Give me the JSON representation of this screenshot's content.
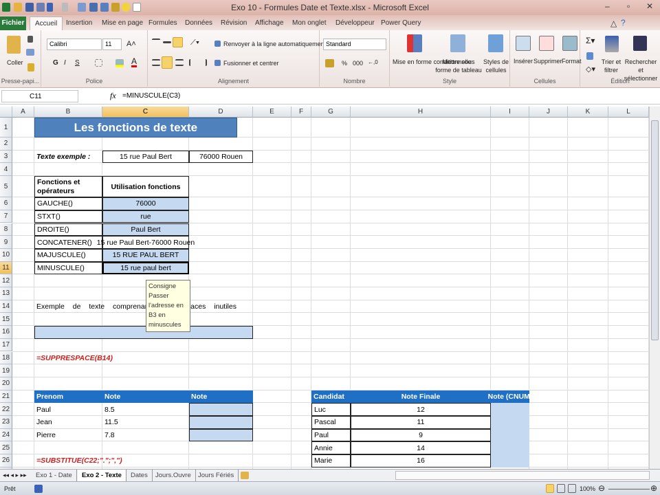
{
  "window": {
    "title": "Exo 10 - Formules Date et Texte.xlsx - Microsoft Excel"
  },
  "tabs": [
    "Fichier",
    "Accueil",
    "Insertion",
    "Mise en page",
    "Formules",
    "Données",
    "Révision",
    "Affichage",
    "Mon onglet",
    "Développeur",
    "Power Query"
  ],
  "ribbon": {
    "clipboard": {
      "paste": "Coller",
      "label": "Presse-papi..."
    },
    "font": {
      "name": "Calibri",
      "size": "11",
      "bold": "G",
      "italic": "I",
      "underline": "S",
      "label": "Police"
    },
    "alignment": {
      "wrap": "Renvoyer à la ligne automatiquement",
      "merge": "Fusionner et centrer",
      "label": "Alignement"
    },
    "number": {
      "format": "Standard",
      "percent": "%",
      "thousands": "000",
      "label": "Nombre"
    },
    "style": {
      "conditional": "Mise en forme conditionnelle",
      "table": "Mettre sous forme de tableau",
      "cellstyles": "Styles de cellules",
      "label": "Style"
    },
    "cells": {
      "insert": "Insérer",
      "delete": "Supprimer",
      "format": "Format",
      "label": "Cellules"
    },
    "editing": {
      "sort": "Trier et filtrer",
      "find": "Rechercher et sélectionner",
      "label": "Édition"
    }
  },
  "formula_bar": {
    "name_box": "C11",
    "fx": "fx",
    "formula": "=MINUSCULE(C3)"
  },
  "columns": [
    "A",
    "B",
    "C",
    "D",
    "E",
    "F",
    "G",
    "H",
    "I",
    "J",
    "K",
    "L"
  ],
  "selected": {
    "column": "C",
    "row": 11
  },
  "cells": [
    {
      "ref": "B1",
      "text": "Les fonctions de texte"
    },
    {
      "ref": "B3",
      "text": "Texte exemple :"
    },
    {
      "ref": "C3",
      "text": "15 rue Paul Bert"
    },
    {
      "ref": "D3",
      "text": "76000 Rouen"
    },
    {
      "ref": "B5",
      "text": "Fonctions et opérateurs"
    },
    {
      "ref": "C5",
      "text": "Utilisation fonctions"
    },
    {
      "ref": "B6",
      "text": "GAUCHE()"
    },
    {
      "ref": "C6",
      "text": "76000"
    },
    {
      "ref": "B7",
      "text": "STXT()"
    },
    {
      "ref": "C7",
      "text": "rue"
    },
    {
      "ref": "B8",
      "text": "DROITE()"
    },
    {
      "ref": "C8",
      "text": "Paul Bert"
    },
    {
      "ref": "B9",
      "text": "CONCATENER()"
    },
    {
      "ref": "C9",
      "text": "15 rue Paul Bert-76000 Rouen"
    },
    {
      "ref": "B10",
      "text": "MAJUSCULE()"
    },
    {
      "ref": "C10",
      "text": "15 RUE PAUL BERT"
    },
    {
      "ref": "B11",
      "text": "MINUSCULE()"
    },
    {
      "ref": "C11",
      "text": "15 rue paul bert"
    },
    {
      "ref": "B14",
      "text": "Exemple   de   texte   comprenant   des   espaces   inutiles"
    },
    {
      "ref": "B16",
      "text": ""
    },
    {
      "ref": "B18",
      "text": "=SUPPRESPACE(B14)"
    },
    {
      "ref": "B21",
      "text": "Prenom"
    },
    {
      "ref": "C21",
      "text": "Note"
    },
    {
      "ref": "D21",
      "text": "Note"
    },
    {
      "ref": "B22",
      "text": "Paul"
    },
    {
      "ref": "C22",
      "text": "8.5"
    },
    {
      "ref": "D22",
      "text": ""
    },
    {
      "ref": "B23",
      "text": "Jean"
    },
    {
      "ref": "C23",
      "text": "11.5"
    },
    {
      "ref": "D23",
      "text": ""
    },
    {
      "ref": "B24",
      "text": "Pierre"
    },
    {
      "ref": "C24",
      "text": "7.8"
    },
    {
      "ref": "D24",
      "text": ""
    },
    {
      "ref": "B26",
      "text": "=SUBSTITUE(C22;\".\";\",\")"
    },
    {
      "ref": "G21",
      "text": "Candidat"
    },
    {
      "ref": "H21",
      "text": "Note Finale"
    },
    {
      "ref": "I21",
      "text": "Note (CNUM)"
    },
    {
      "ref": "G22",
      "text": "Luc"
    },
    {
      "ref": "H22",
      "text": "12"
    },
    {
      "ref": "I22",
      "text": ""
    },
    {
      "ref": "G23",
      "text": "Pascal"
    },
    {
      "ref": "H23",
      "text": "11"
    },
    {
      "ref": "I23",
      "text": ""
    },
    {
      "ref": "G24",
      "text": "Paul"
    },
    {
      "ref": "H24",
      "text": "9"
    },
    {
      "ref": "I24",
      "text": ""
    },
    {
      "ref": "G25",
      "text": "Annie"
    },
    {
      "ref": "H25",
      "text": "14"
    },
    {
      "ref": "I25",
      "text": ""
    },
    {
      "ref": "G26",
      "text": "Marie"
    },
    {
      "ref": "H26",
      "text": "16"
    },
    {
      "ref": "I26",
      "text": ""
    }
  ],
  "comment": {
    "title": "Consigne",
    "body": "Passer l'adresse en B3 en minuscules"
  },
  "sheet_tabs": [
    "Exo 1 - Date",
    "Exo 2 - Texte",
    "Dates",
    "Jours.Ouvre",
    "Jours Fériés"
  ],
  "active_sheet": "Exo 2 - Texte",
  "status": {
    "mode": "Prêt",
    "zoom": "100%"
  }
}
